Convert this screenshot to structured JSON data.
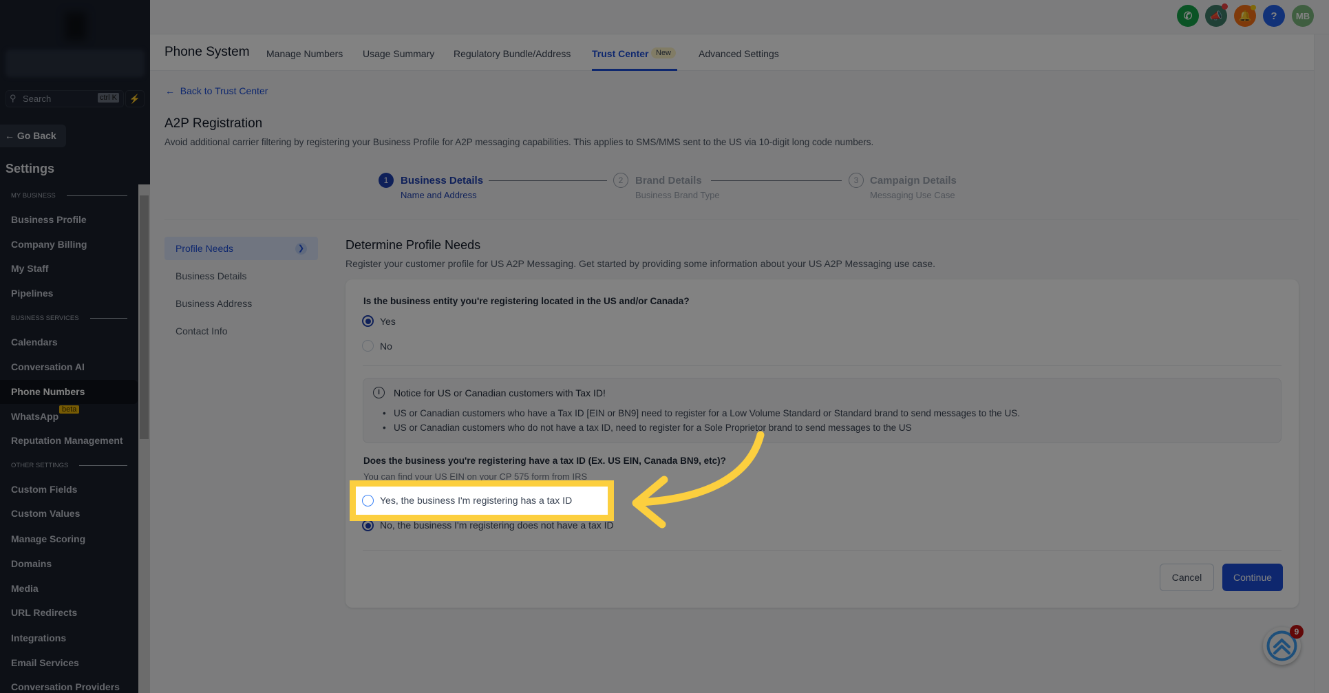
{
  "sidebar": {
    "search_placeholder": "Search",
    "search_shortcut": "ctrl K",
    "go_back": "Go Back",
    "title": "Settings",
    "sections": {
      "my_business": "MY BUSINESS",
      "business_services": "BUSINESS SERVICES",
      "other_settings": "OTHER SETTINGS"
    },
    "items": [
      "Business Profile",
      "Company Billing",
      "My Staff",
      "Pipelines",
      "Calendars",
      "Conversation AI",
      "Phone Numbers",
      "WhatsApp",
      "Reputation Management",
      "Custom Fields",
      "Custom Values",
      "Manage Scoring",
      "Domains",
      "Media",
      "URL Redirects",
      "Integrations",
      "Email Services",
      "Conversation Providers"
    ],
    "active": "Phone Numbers",
    "beta_badge": "beta"
  },
  "topbar": {
    "avatar_initials": "MB",
    "icons": [
      "phone-icon",
      "megaphone-icon",
      "bell-icon",
      "help-icon"
    ]
  },
  "tabs": {
    "title": "Phone System",
    "items": [
      "Manage Numbers",
      "Usage Summary",
      "Regulatory Bundle/Address",
      "Trust Center",
      "Advanced Settings"
    ],
    "active": "Trust Center",
    "new_badge": "New"
  },
  "back_link": "Back to Trust Center",
  "page": {
    "title": "A2P Registration",
    "description": "Avoid additional carrier filtering by registering your Business Profile for A2P messaging capabilities. This applies to SMS/MMS sent to the US via 10-digit long code numbers."
  },
  "stepper": [
    {
      "num": "1",
      "title": "Business Details",
      "sub": "Name and Address"
    },
    {
      "num": "2",
      "title": "Brand Details",
      "sub": "Business Brand Type"
    },
    {
      "num": "3",
      "title": "Campaign Details",
      "sub": "Messaging Use Case"
    }
  ],
  "subnav": [
    "Profile Needs",
    "Business Details",
    "Business Address",
    "Contact Info"
  ],
  "form": {
    "title": "Determine Profile Needs",
    "description": "Register your customer profile for US A2P Messaging. Get started by providing some information about your US A2P Messaging use case.",
    "q1": "Is the business entity you're registering located in the US and/or Canada?",
    "q1_yes": "Yes",
    "q1_no": "No",
    "q1_selected": "Yes",
    "notice_title": "Notice for US or Canadian customers with Tax ID!",
    "notice_bullets": [
      "US or Canadian customers who have a Tax ID [EIN or BN9] need to register for a Low Volume Standard or Standard brand to send messages to the US.",
      "US or Canadian customers who do not have a tax ID, need to register for a Sole Proprietor brand to send messages to the US"
    ],
    "q2": "Does the business you're registering have a tax ID (Ex. US EIN, Canada BN9, etc)?",
    "q2_hint": "You can find your US EIN on your CP 575 form from IRS",
    "q2_yes": "Yes, the business I'm registering has a tax ID",
    "q2_no": "No, the business I'm registering does not have a tax ID",
    "q2_selected": "No",
    "cancel": "Cancel",
    "continue": "Continue"
  },
  "help_widget_badge": "9",
  "colors": {
    "primary": "#1e40af",
    "highlight": "#fccf3f"
  }
}
